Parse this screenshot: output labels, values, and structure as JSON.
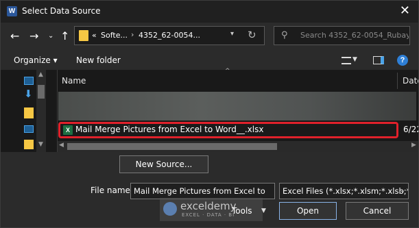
{
  "window": {
    "app_icon": "W",
    "title": "Select Data Source",
    "close_glyph": "✕"
  },
  "address": {
    "crumbs": [
      "Softe...",
      "4352_62-0054..."
    ],
    "overflow": "«",
    "separator": "›"
  },
  "search": {
    "placeholder": "Search 4352_62-0054_Rubay..."
  },
  "toolbar": {
    "organize_label": "Organize ▾",
    "new_folder_label": "New folder"
  },
  "columns": {
    "name": "Name",
    "date": "Date"
  },
  "files": [
    {
      "name": "Mail Merge Pictures from Excel to Word__.xlsx",
      "date": "6/22",
      "icon": "X",
      "selected": true
    }
  ],
  "bottom": {
    "new_source_label": "New Source...",
    "file_name_label": "File name:",
    "file_name_value": "Mail Merge Pictures from Excel to",
    "file_type_value": "Excel Files (*.xlsx;*.xlsm;*.xlsb;*",
    "tools_label": "Tools",
    "open_label": "Open",
    "cancel_label": "Cancel"
  },
  "watermark": {
    "name": "exceldemy",
    "tagline": "EXCEL · DATA · BI"
  },
  "colors": {
    "selection_highlight": "#e0212b",
    "excel_icon": "#1d6f42",
    "word_icon": "#2b579a",
    "folder": "#f6c744"
  }
}
